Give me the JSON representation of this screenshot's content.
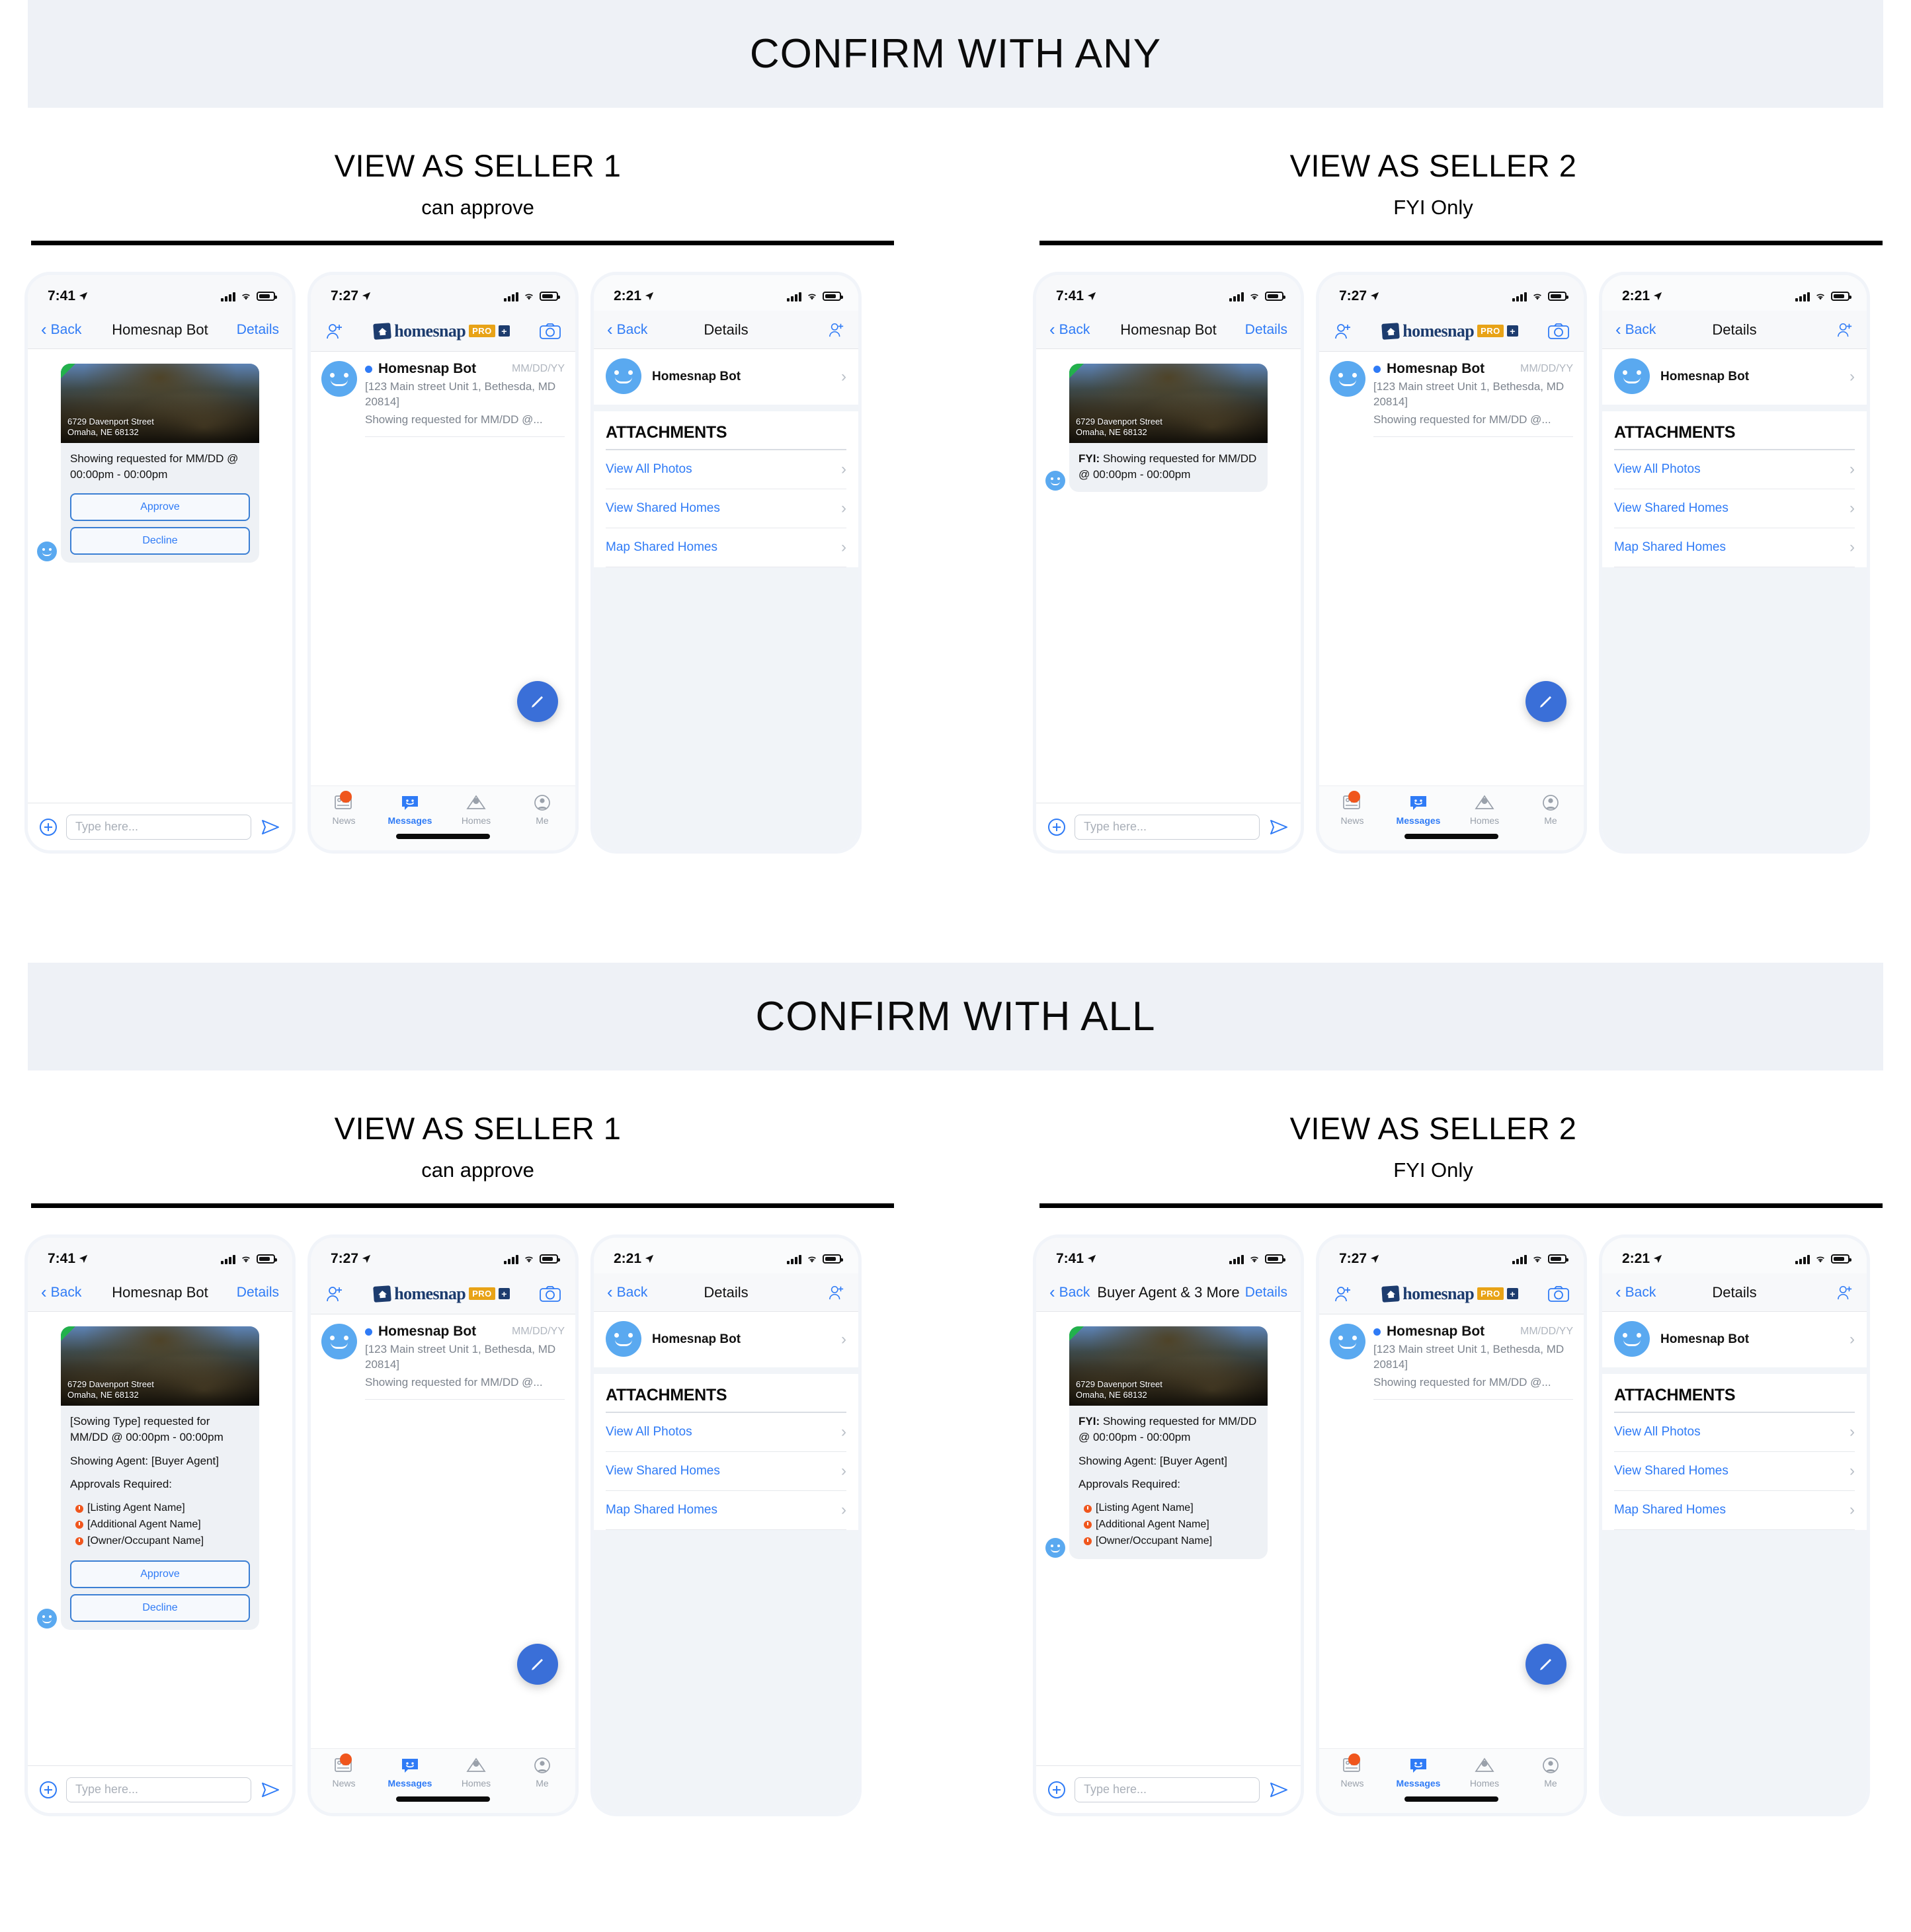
{
  "sections": [
    {
      "banner_title": "CONFIRM WITH ANY",
      "columns": [
        {
          "title": "VIEW AS SELLER 1",
          "subtitle": "can approve"
        },
        {
          "title": "VIEW AS SELLER 2",
          "subtitle": "FYI Only"
        }
      ]
    },
    {
      "banner_title": "CONFIRM WITH ALL",
      "columns": [
        {
          "title": "VIEW AS SELLER 1",
          "subtitle": "can approve"
        },
        {
          "title": "VIEW AS SELLER 2",
          "subtitle": "FYI Only"
        }
      ]
    }
  ],
  "status_bar": {
    "time_chat": "7:41",
    "time_messages": "7:27",
    "time_details": "2:21"
  },
  "nav": {
    "back": "Back",
    "details": "Details",
    "title_bot": "Homesnap Bot",
    "title_group": "Buyer Agent & 3 More",
    "details_title": "Details"
  },
  "logo": {
    "word": "homesnap",
    "pro": "PRO",
    "plus": "+"
  },
  "listing": {
    "address_line1": "6729 Davenport Street",
    "address_line2": "Omaha, NE 68132"
  },
  "messages": {
    "any_seller1_text": "Showing requested for MM/DD @ 00:00pm - 00:00pm",
    "any_seller2_prefix": "FYI:",
    "any_seller2_text": "Showing requested for MM/DD @ 00:00pm - 00:00pm",
    "all_seller1_line1": "[Sowing Type] requested for MM/DD @ 00:00pm - 00:00pm",
    "all_seller1_line2": "Showing Agent: [Buyer Agent]",
    "all_seller1_line3": "Approvals Required:",
    "all_seller2_prefix": "FYI:",
    "all_seller2_line1": "Showing requested for MM/DD @ 00:00pm - 00:00pm",
    "all_seller2_line2": "Showing Agent: [Buyer Agent]",
    "all_seller2_line3": "Approvals Required:",
    "approvals": [
      "[Listing Agent Name]",
      "[Additional Agent Name]",
      "[Owner/Occupant Name]"
    ]
  },
  "buttons": {
    "approve": "Approve",
    "decline": "Decline"
  },
  "composer": {
    "placeholder": "Type here..."
  },
  "messages_list": {
    "name": "Homesnap Bot",
    "date": "MM/DD/YY",
    "preview_line1": "[123 Main street Unit 1, Bethesda, MD 20814]",
    "preview_line2": "Showing requested for MM/DD @..."
  },
  "tabbar": {
    "items": [
      {
        "label": "News",
        "icon": "news-icon",
        "active": false,
        "badge": true
      },
      {
        "label": "Messages",
        "icon": "messages-icon",
        "active": true,
        "badge": false
      },
      {
        "label": "Homes",
        "icon": "homes-icon",
        "active": false,
        "badge": false
      },
      {
        "label": "Me",
        "icon": "profile-icon",
        "active": false,
        "badge": false
      }
    ]
  },
  "details": {
    "contact_name": "Homesnap Bot",
    "section_title": "ATTACHMENTS",
    "rows": [
      "View All Photos",
      "View Shared Homes",
      "Map Shared Homes"
    ]
  },
  "colors": {
    "banner_bg": "#eef1f6",
    "link_blue": "#2f7bf6",
    "avatar_blue": "#5aa9f0",
    "bubble_gray": "#eef1f5",
    "badge_orange": "#f0561d",
    "brand_navy": "#1d3c6e",
    "pro_gold": "#e8a317",
    "fab_blue": "#3a6fd8",
    "corner_green": "#22b14c"
  }
}
